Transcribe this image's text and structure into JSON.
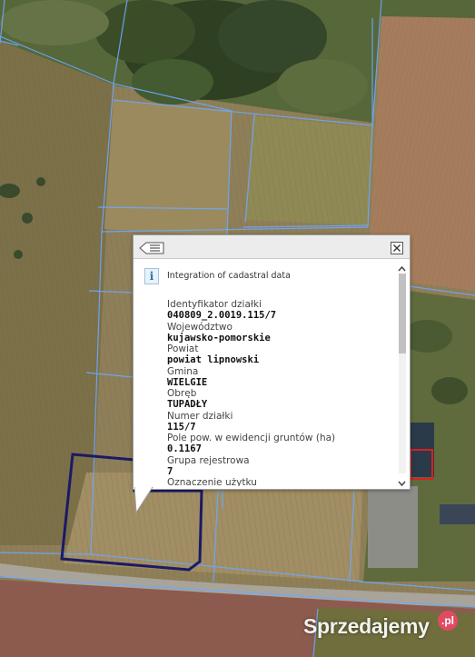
{
  "popup": {
    "title": "Integration of cadastral data",
    "info_icon_glyph": "i",
    "menu_icon": "list-menu-icon",
    "close_icon": "close-icon",
    "fields": [
      {
        "label": "Identyfikator działki",
        "value": "040809_2.0019.115/7"
      },
      {
        "label": "Województwo",
        "value": "kujawsko-pomorskie"
      },
      {
        "label": "Powiat",
        "value": "powiat lipnowski"
      },
      {
        "label": "Gmina",
        "value": "WIELGIE"
      },
      {
        "label": "Obręb",
        "value": "TUPADŁY"
      },
      {
        "label": "Numer działki",
        "value": "115/7"
      },
      {
        "label": "Pole pow. w ewidencji gruntów (ha)",
        "value": "0.1167"
      },
      {
        "label": "Grupa rejestrowa",
        "value": "7"
      },
      {
        "label": "Oznaczenie użytku",
        "value": ""
      }
    ],
    "scroll_position": 0
  },
  "watermark": {
    "text": "Sprzedajemy",
    "badge": ".pl"
  },
  "colors": {
    "parcel_lines": "#6ea8ff",
    "selected_parcel": "#1a1a66",
    "building_highlight": "#d92020",
    "popup_header": "#ececec"
  }
}
